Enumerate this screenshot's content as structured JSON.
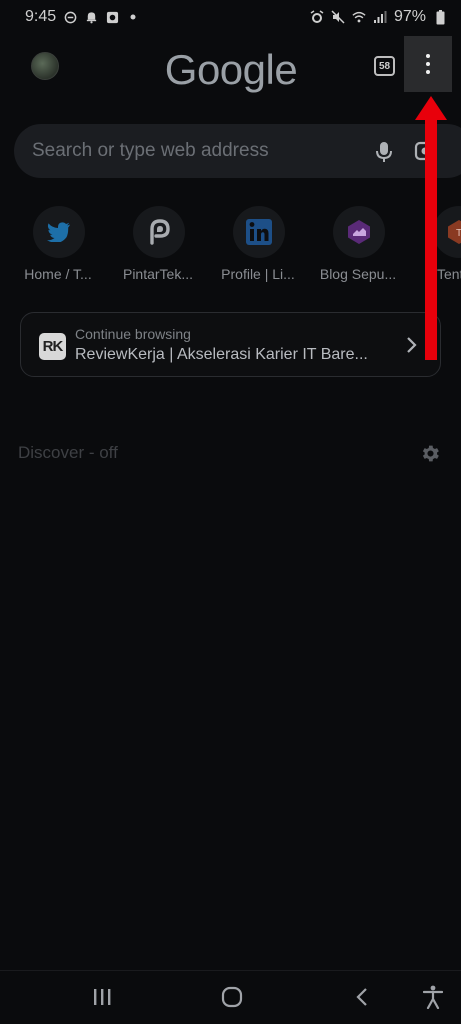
{
  "status_bar": {
    "time": "9:45",
    "battery": "97%",
    "left_icons": [
      "do-not-disturb-icon",
      "alarm-bell-icon",
      "screen-record-icon",
      "dot-icon"
    ],
    "right_icons": [
      "alarm-icon",
      "mute-icon",
      "wifi-icon",
      "signal-icon",
      "battery-icon"
    ]
  },
  "toolbar": {
    "logo": "Google",
    "tab_count": "58",
    "menu_icon": "more-vert-icon"
  },
  "search": {
    "placeholder": "Search or type web address",
    "mic_icon": "mic-icon",
    "lens_icon": "lens-icon"
  },
  "shortcuts": [
    {
      "label": "Home / T...",
      "icon": "twitter-icon"
    },
    {
      "label": "PintarTek...",
      "icon": "pintartekno-icon"
    },
    {
      "label": "Profile | Li...",
      "icon": "linkedin-icon"
    },
    {
      "label": "Blog Sepu...",
      "icon": "blog-icon"
    },
    {
      "label": "Tentan",
      "icon": "tentang-icon"
    }
  ],
  "continue_browsing": {
    "icon_text": "RK",
    "title": "Continue browsing",
    "page": "ReviewKerja | Akselerasi Karier IT Bare..."
  },
  "discover": {
    "label": "Discover - off",
    "settings_icon": "gear-icon"
  },
  "annotation": {
    "arrow_color": "#ff0000"
  },
  "nav_bar": {
    "icons": [
      "recents-icon",
      "home-icon",
      "back-icon",
      "accessibility-icon"
    ]
  },
  "colors": {
    "background": "#0a0b0d",
    "twitter_blue": "#1d9bf0",
    "linkedin_blue": "#0a66c2"
  }
}
